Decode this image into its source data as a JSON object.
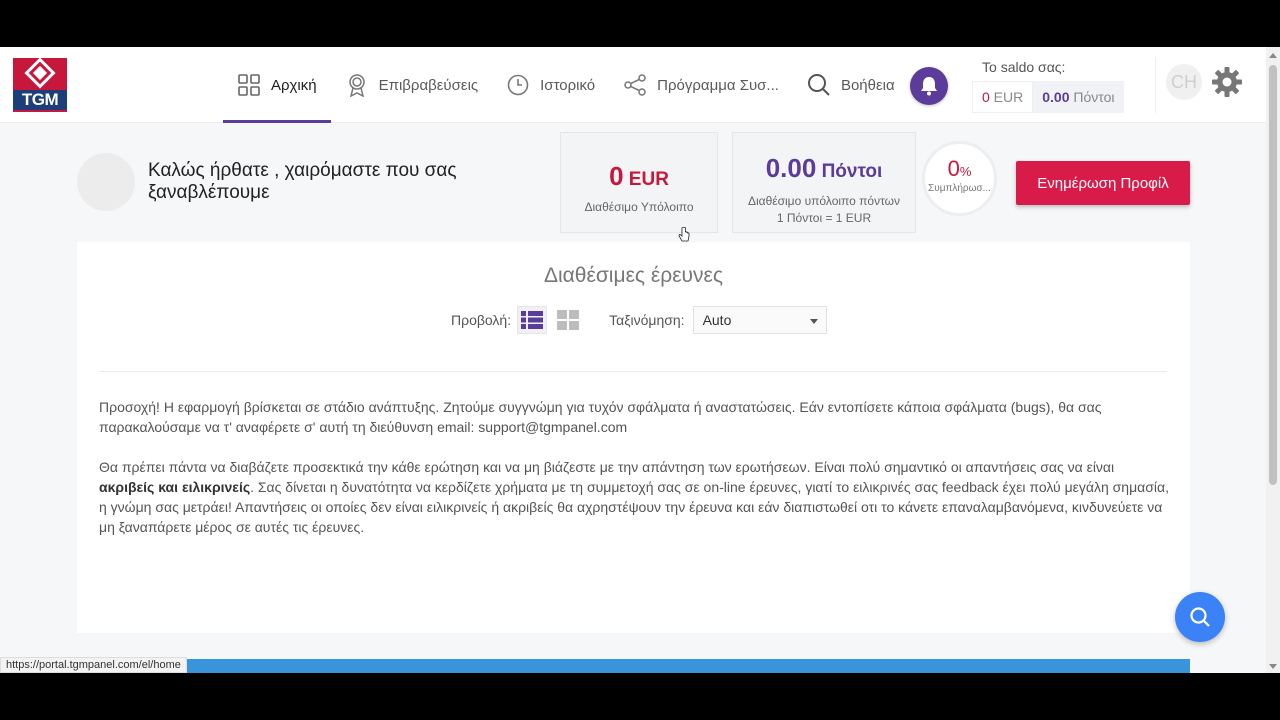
{
  "brand": {
    "logo_text": "TGM",
    "accent": "#c8173c",
    "primary": "#5b3c9a"
  },
  "nav": {
    "items": [
      {
        "label": "Αρχική",
        "icon": "grid-icon",
        "active": true
      },
      {
        "label": "Επιβραβεύσεις",
        "icon": "award-icon",
        "active": false
      },
      {
        "label": "Ιστορικό",
        "icon": "clock-icon",
        "active": false
      },
      {
        "label": "Πρόγραμμα Συσ...",
        "icon": "share-icon",
        "active": false
      },
      {
        "label": "Βοήθεια",
        "icon": "search-icon",
        "active": false
      }
    ]
  },
  "saldo": {
    "title": "Το saldo σας:",
    "eur_value": "0",
    "eur_unit": " EUR",
    "points_value": "0.00",
    "points_unit": " Πόντοι"
  },
  "user": {
    "initials": "CH"
  },
  "welcome": {
    "text": "Καλώς ήρθατε , χαιρόμαστε που σας ξαναβλέπουμε"
  },
  "cards": {
    "balance": {
      "value": "0",
      "unit": " EUR",
      "label": "Διαθέσιμο Υπόλοιπο"
    },
    "points": {
      "value": "0.00",
      "unit": " Πόντοι",
      "label": "Διαθέσιμο υπόλοιπο πόντων",
      "rate": "1 Πόντοι = 1 EUR"
    }
  },
  "completion": {
    "value": "0",
    "unit": "%",
    "label": "Συμπλήρωσ..."
  },
  "profile_button": {
    "label": "Ενημέρωση Προφίλ"
  },
  "surveys": {
    "title": "Διαθέσιμες έρευνες",
    "view_label": "Προβολή:",
    "sort_label": "Ταξινόμηση:",
    "sort_value": "Auto"
  },
  "notices": {
    "p1": "Προσοχή! Η εφαρμογή βρίσκεται σε στάδιο ανάπτυξης. Ζητούμε συγγνώμη για τυχόν σφάλματα ή αναστατώσεις. Εάν εντοπίσετε κάποια σφάλματα (bugs), θα σας παρακαλούσαμε να τ' αναφέρετε σ' αυτή τη διεύθυνση email: support@tgmpanel.com",
    "p2_before": "Θα πρέπει πάντα να διαβάζετε προσεκτικά την κάθε ερώτηση και να μη βιάζεστε με την απάντηση των ερωτήσεων. Είναι πολύ σημαντικό οι απαντήσεις σας να είναι ",
    "p2_bold": "ακριβείς και ειλικρινείς",
    "p2_after": ". Σας δίνεται η δυνατότητα να κερδίζετε χρήματα με τη συμμετοχή σας σε on-line έρευνες, γιατί το ειλικρινές σας feedback έχει πολύ μεγάλη σημασία, η γνώμη σας μετράει! Απαντήσεις οι οποίες δεν είναι ειλικρινείς ή ακριβείς θα αχρηστέψουν την έρευνα και εάν διαπιστωθεί οτι το κάνετε επαναλαμβανόμενα, κινδυνεύετε να μη ξαναπάρετε μέρος σε αυτές τις έρευνες."
  },
  "status_bar": {
    "url": "https://portal.tgmpanel.com/el/home"
  }
}
